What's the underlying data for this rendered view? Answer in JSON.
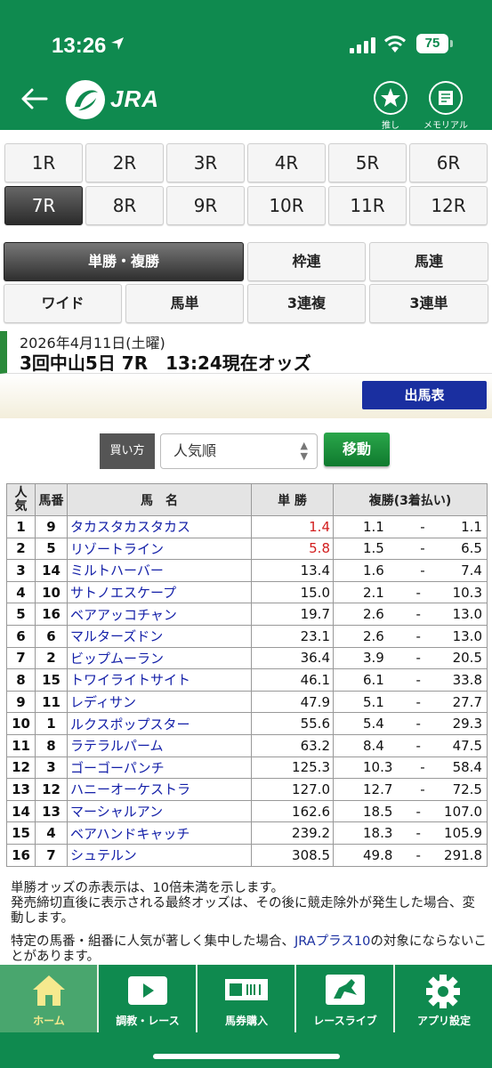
{
  "status": {
    "time": "13:26",
    "battery": "75"
  },
  "header": {
    "logo_text": "JRA",
    "fav_label": "推し",
    "memorial_label": "メモリアル"
  },
  "races": [
    "1R",
    "2R",
    "3R",
    "4R",
    "5R",
    "6R",
    "7R",
    "8R",
    "9R",
    "10R",
    "11R",
    "12R"
  ],
  "active_race": "7R",
  "bet_types": [
    "単勝・複勝",
    "枠連",
    "馬連",
    "ワイド",
    "馬単",
    "3連複",
    "3連単"
  ],
  "info": {
    "date": "2026年4月11日(土曜)",
    "title": "3回中山5日 7R　13:24現在オッズ"
  },
  "shutuba_label": "出馬表",
  "sort": {
    "label": "買い方",
    "value": "人気順",
    "move_label": "移動"
  },
  "table": {
    "headers": {
      "rank": "人気",
      "num": "馬番",
      "name": "馬　名",
      "win": "単 勝",
      "place": "複勝(3着払い)"
    },
    "rows": [
      {
        "rank": "1",
        "num": "9",
        "name": "タカスタカスタカス",
        "win": "1.4",
        "red": true,
        "pmin": "1.1",
        "pmax": "1.1"
      },
      {
        "rank": "2",
        "num": "5",
        "name": "リゾートライン",
        "win": "5.8",
        "red": true,
        "pmin": "1.5",
        "pmax": "6.5"
      },
      {
        "rank": "3",
        "num": "14",
        "name": "ミルトハーバー",
        "win": "13.4",
        "red": false,
        "pmin": "1.6",
        "pmax": "7.4"
      },
      {
        "rank": "4",
        "num": "10",
        "name": "サトノエスケープ",
        "win": "15.0",
        "red": false,
        "pmin": "2.1",
        "pmax": "10.3"
      },
      {
        "rank": "5",
        "num": "16",
        "name": "ベアアッコチャン",
        "win": "19.7",
        "red": false,
        "pmin": "2.6",
        "pmax": "13.0"
      },
      {
        "rank": "6",
        "num": "6",
        "name": "マルターズドン",
        "win": "23.1",
        "red": false,
        "pmin": "2.6",
        "pmax": "13.0"
      },
      {
        "rank": "7",
        "num": "2",
        "name": "ビップムーラン",
        "win": "36.4",
        "red": false,
        "pmin": "3.9",
        "pmax": "20.5"
      },
      {
        "rank": "8",
        "num": "15",
        "name": "トワイライトサイト",
        "win": "46.1",
        "red": false,
        "pmin": "6.1",
        "pmax": "33.8"
      },
      {
        "rank": "9",
        "num": "11",
        "name": "レディサン",
        "win": "47.9",
        "red": false,
        "pmin": "5.1",
        "pmax": "27.7"
      },
      {
        "rank": "10",
        "num": "1",
        "name": "ルクスポップスター",
        "win": "55.6",
        "red": false,
        "pmin": "5.4",
        "pmax": "29.3"
      },
      {
        "rank": "11",
        "num": "8",
        "name": "ラテラルパーム",
        "win": "63.2",
        "red": false,
        "pmin": "8.4",
        "pmax": "47.5"
      },
      {
        "rank": "12",
        "num": "3",
        "name": "ゴーゴーパンチ",
        "win": "125.3",
        "red": false,
        "pmin": "10.3",
        "pmax": "58.4"
      },
      {
        "rank": "13",
        "num": "12",
        "name": "ハニーオーケストラ",
        "win": "127.0",
        "red": false,
        "pmin": "12.7",
        "pmax": "72.5"
      },
      {
        "rank": "14",
        "num": "13",
        "name": "マーシャルアン",
        "win": "162.6",
        "red": false,
        "pmin": "18.5",
        "pmax": "107.0"
      },
      {
        "rank": "15",
        "num": "4",
        "name": "ベアハンドキャッチ",
        "win": "239.2",
        "red": false,
        "pmin": "18.3",
        "pmax": "105.9"
      },
      {
        "rank": "16",
        "num": "7",
        "name": "シュテルン",
        "win": "308.5",
        "red": false,
        "pmin": "49.8",
        "pmax": "291.8"
      }
    ]
  },
  "notes": {
    "line1": "単勝オッズの赤表示は、10倍未満を示します。",
    "line2": "発売締切直後に表示される最終オッズは、その後に競走除外が発生した場合、変動します。",
    "line3_pre": "特定の馬番・組番に人気が著しく集中した場合、",
    "line3_link": "JRAプラス10",
    "line3_post": "の対象にならないことがあります。"
  },
  "tabs": [
    "ホーム",
    "調教・レース",
    "馬券購入",
    "レースライブ",
    "アプリ設定"
  ],
  "colors": {
    "brand_green": "#0f8a4f",
    "red_odds": "#d21e1e",
    "link_blue": "#1420a8"
  }
}
